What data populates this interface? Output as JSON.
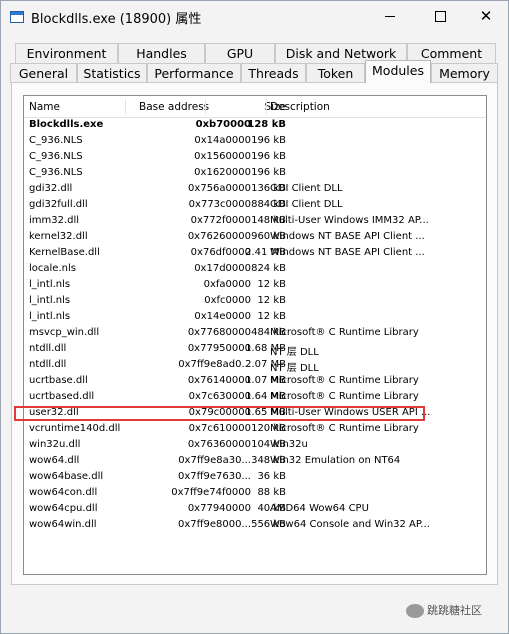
{
  "window": {
    "title": "Blockdlls.exe (18900) 属性"
  },
  "tabs": {
    "row1": [
      "Environment",
      "Handles",
      "GPU",
      "Disk and Network",
      "Comment"
    ],
    "row2": [
      "General",
      "Statistics",
      "Performance",
      "Threads",
      "Token",
      "Modules",
      "Memory"
    ],
    "active": "Modules"
  },
  "columns": {
    "name": "Name",
    "base": "Base address",
    "size": "Size",
    "desc": "Description"
  },
  "modules": [
    {
      "name": "Blockdlls.exe",
      "base": "0xb70000",
      "size": "128 kB",
      "desc": ""
    },
    {
      "name": "C_936.NLS",
      "base": "0x14a0000",
      "size": "196 kB",
      "desc": ""
    },
    {
      "name": "C_936.NLS",
      "base": "0x1560000",
      "size": "196 kB",
      "desc": ""
    },
    {
      "name": "C_936.NLS",
      "base": "0x1620000",
      "size": "196 kB",
      "desc": ""
    },
    {
      "name": "gdi32.dll",
      "base": "0x756a0000",
      "size": "136 kB",
      "desc": "GDI Client DLL"
    },
    {
      "name": "gdi32full.dll",
      "base": "0x773c0000",
      "size": "884 kB",
      "desc": "GDI Client DLL"
    },
    {
      "name": "imm32.dll",
      "base": "0x772f0000",
      "size": "148 kB",
      "desc": "Multi-User Windows IMM32 AP..."
    },
    {
      "name": "kernel32.dll",
      "base": "0x76260000",
      "size": "960 kB",
      "desc": "Windows NT BASE API Client ..."
    },
    {
      "name": "KernelBase.dll",
      "base": "0x76df0000",
      "size": "2.41 MB",
      "desc": "Windows NT BASE API Client ..."
    },
    {
      "name": "locale.nls",
      "base": "0x17d0000",
      "size": "824 kB",
      "desc": ""
    },
    {
      "name": "l_intl.nls",
      "base": "0xfa0000",
      "size": "12 kB",
      "desc": ""
    },
    {
      "name": "l_intl.nls",
      "base": "0xfc0000",
      "size": "12 kB",
      "desc": ""
    },
    {
      "name": "l_intl.nls",
      "base": "0x14e0000",
      "size": "12 kB",
      "desc": ""
    },
    {
      "name": "msvcp_win.dll",
      "base": "0x77680000",
      "size": "484 kB",
      "desc": "Microsoft® C Runtime Library"
    },
    {
      "name": "ntdll.dll",
      "base": "0x77950000",
      "size": "1.68 MB",
      "desc": "NT 层 DLL"
    },
    {
      "name": "ntdll.dll",
      "base": "0x7ff9e8ad0...",
      "size": "2.07 MB",
      "desc": "NT 层 DLL"
    },
    {
      "name": "ucrtbase.dll",
      "base": "0x76140000",
      "size": "1.07 MB",
      "desc": "Microsoft® C Runtime Library"
    },
    {
      "name": "ucrtbased.dll",
      "base": "0x7c630000",
      "size": "1.64 MB",
      "desc": "Microsoft® C Runtime Library"
    },
    {
      "name": "user32.dll",
      "base": "0x79c00000",
      "size": "1.65 MB",
      "desc": "Multi-User Windows USER API ..."
    },
    {
      "name": "vcruntime140d.dll",
      "base": "0x7c610000",
      "size": "120 kB",
      "desc": "Microsoft® C Runtime Library"
    },
    {
      "name": "win32u.dll",
      "base": "0x76360000",
      "size": "104 kB",
      "desc": "Win32u"
    },
    {
      "name": "wow64.dll",
      "base": "0x7ff9e8a30...",
      "size": "348 kB",
      "desc": "Win32 Emulation on NT64"
    },
    {
      "name": "wow64base.dll",
      "base": "0x7ff9e7630...",
      "size": "36 kB",
      "desc": ""
    },
    {
      "name": "wow64con.dll",
      "base": "0x7ff9e74f0000",
      "size": "88 kB",
      "desc": ""
    },
    {
      "name": "wow64cpu.dll",
      "base": "0x77940000",
      "size": "40 kB",
      "desc": "AMD64 Wow64 CPU"
    },
    {
      "name": "wow64win.dll",
      "base": "0x7ff9e8000...",
      "size": "556 kB",
      "desc": "Wow64 Console and Win32 AP..."
    }
  ],
  "selected_module": "user32.dll",
  "watermark": {
    "text": "跳跳糖社区"
  },
  "colors": {
    "highlight_border": "#e03a3a"
  }
}
